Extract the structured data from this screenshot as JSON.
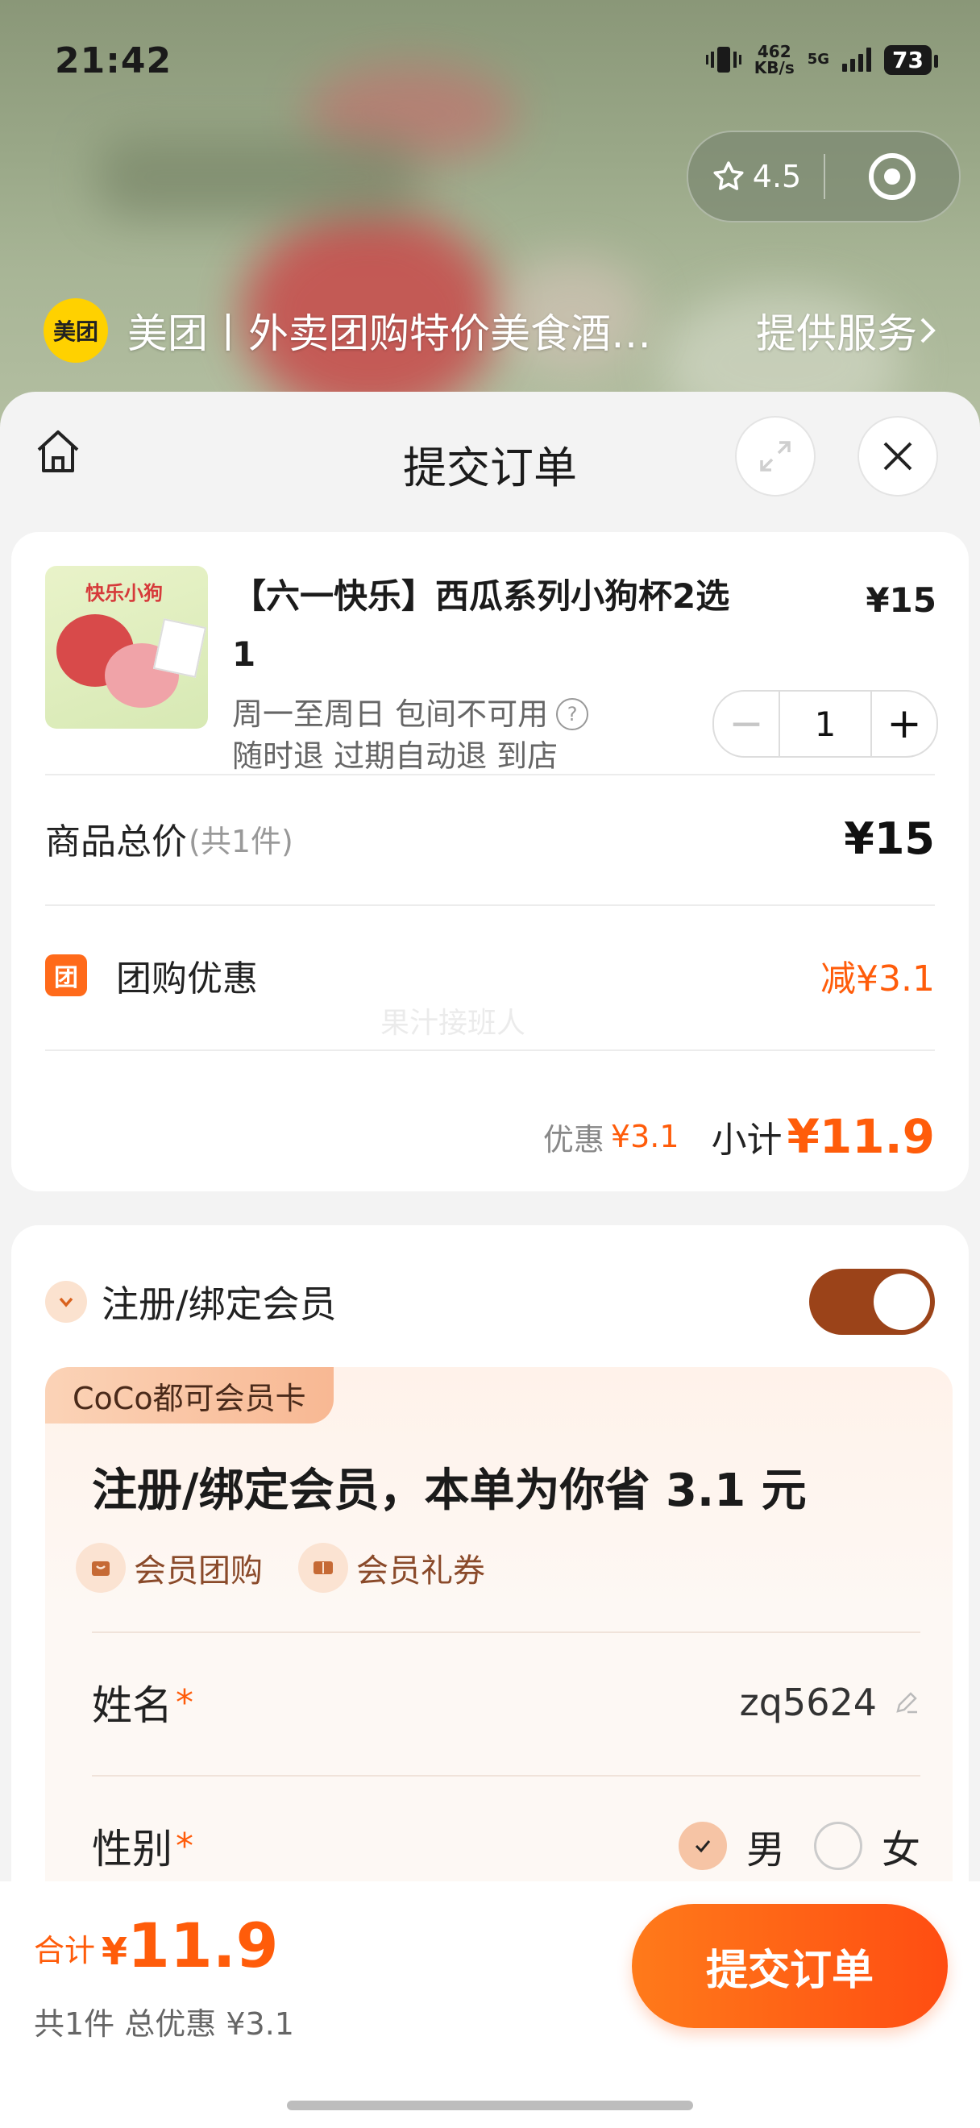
{
  "status_bar": {
    "time": "21:42",
    "net_speed": "462",
    "net_unit": "KB/s",
    "network": "5G",
    "battery": "73"
  },
  "capsule": {
    "rating": "4.5"
  },
  "brand": {
    "logo_text": "美团",
    "title": "美团丨外卖团购特价美食酒…",
    "service": "提供服务"
  },
  "sheet": {
    "title": "提交订单"
  },
  "product": {
    "image_text": "快乐小狗",
    "name": "【六一快乐】西瓜系列小狗杯2选1",
    "price": "¥15",
    "line1": "周一至周日 包间不可用",
    "line2": "随时退 过期自动退 到店",
    "quantity": "1",
    "minus": "−",
    "plus": "+"
  },
  "totals": {
    "label": "商品总价",
    "count": "(共1件)",
    "value": "¥15",
    "discount_icon": "团",
    "discount_label": "团购优惠",
    "discount_value": "减¥3.1",
    "watermark": "果汁接班人",
    "saved_label": "优惠",
    "saved_value": "¥3.1",
    "subtotal_label": "小计",
    "subtotal_value": "¥11.9"
  },
  "membership": {
    "title": "注册/绑定会员",
    "toggle_on": true,
    "card_tag": "CoCo都可会员卡",
    "headline": "注册/绑定会员，本单为你省 3.1 元",
    "perks": [
      "会员团购",
      "会员礼券"
    ],
    "name_label": "姓名",
    "required_mark": "*",
    "name_value": "zq5624",
    "gender_label": "性别",
    "gender_options": [
      "男",
      "女"
    ],
    "gender_selected": "男"
  },
  "bottom": {
    "sum_label": "合计",
    "currency": "¥",
    "sum_value": "11.9",
    "summary": "共1件 总优惠 ¥3.1",
    "submit": "提交订单"
  },
  "colors": {
    "accent": "#ff5c0a",
    "toggle": "#9b4319",
    "meituan_yellow": "#ffd100"
  },
  "icons": [
    "home-icon",
    "expand-icon",
    "close-icon",
    "star-icon",
    "target-icon",
    "chevron-right-icon",
    "help-icon",
    "chevron-down-icon",
    "edit-icon",
    "check-icon"
  ]
}
